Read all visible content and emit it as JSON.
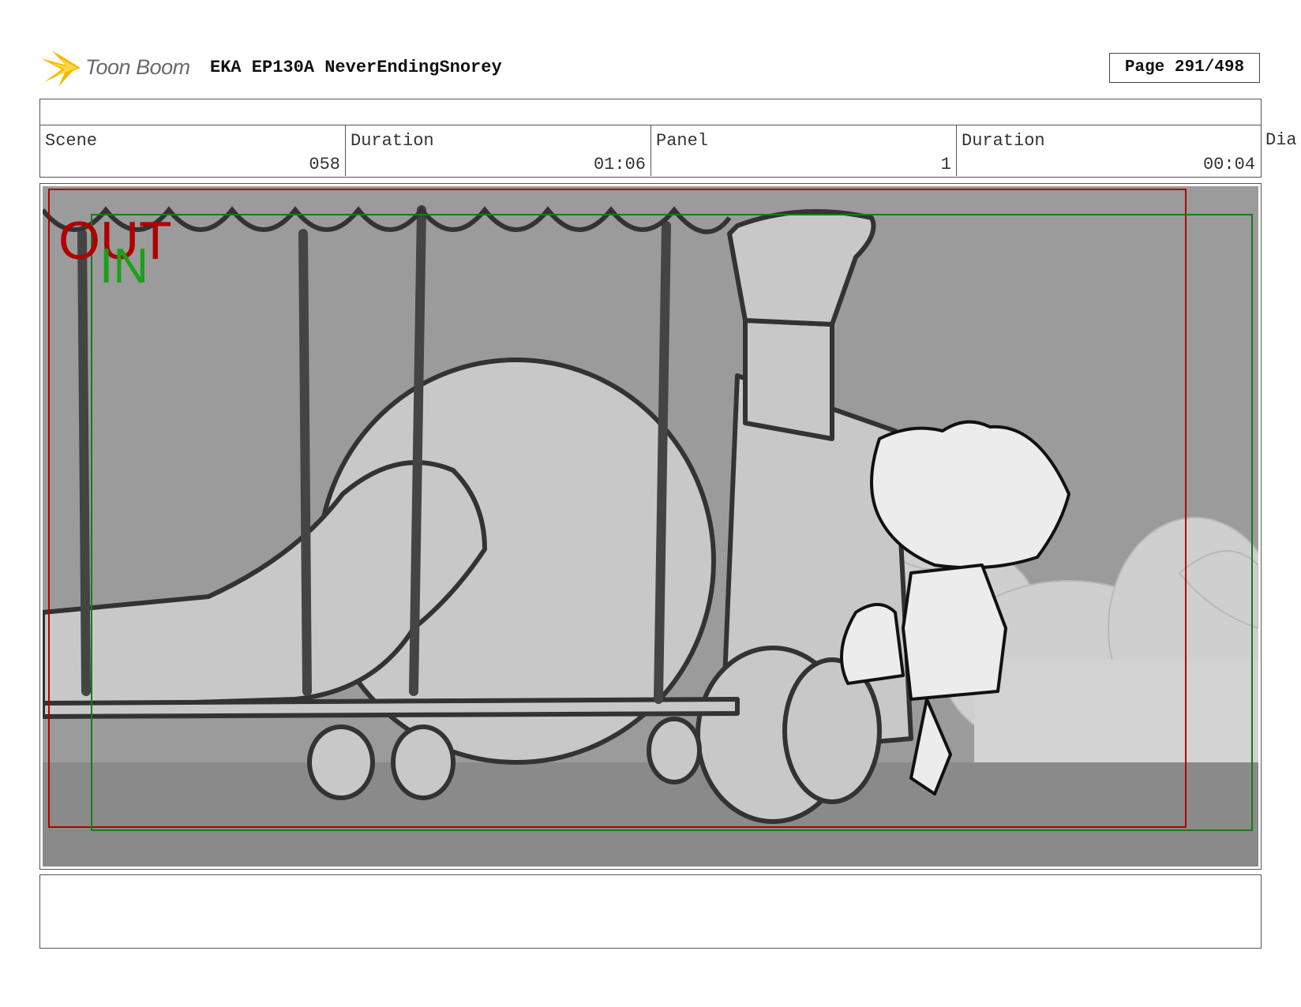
{
  "header": {
    "brand": "Toon Boom",
    "title": "EKA EP130A NeverEndingSnorey",
    "page": "Page 291/498"
  },
  "info": {
    "scene_label": "Scene",
    "scene_value": "058",
    "scene_duration_label": "Duration",
    "scene_duration_value": "01:06",
    "panel_label": "Panel",
    "panel_value": "1",
    "panel_duration_label": "Duration",
    "panel_duration_value": "00:04",
    "dialog_label": "Dia"
  },
  "frame_overlay": {
    "out_label": "OUT",
    "in_label": "IN",
    "out_color": "#b00000",
    "in_color": "#1aa01a"
  },
  "colors": {
    "border": "#555555",
    "brand_yellow": "#f5b800"
  }
}
